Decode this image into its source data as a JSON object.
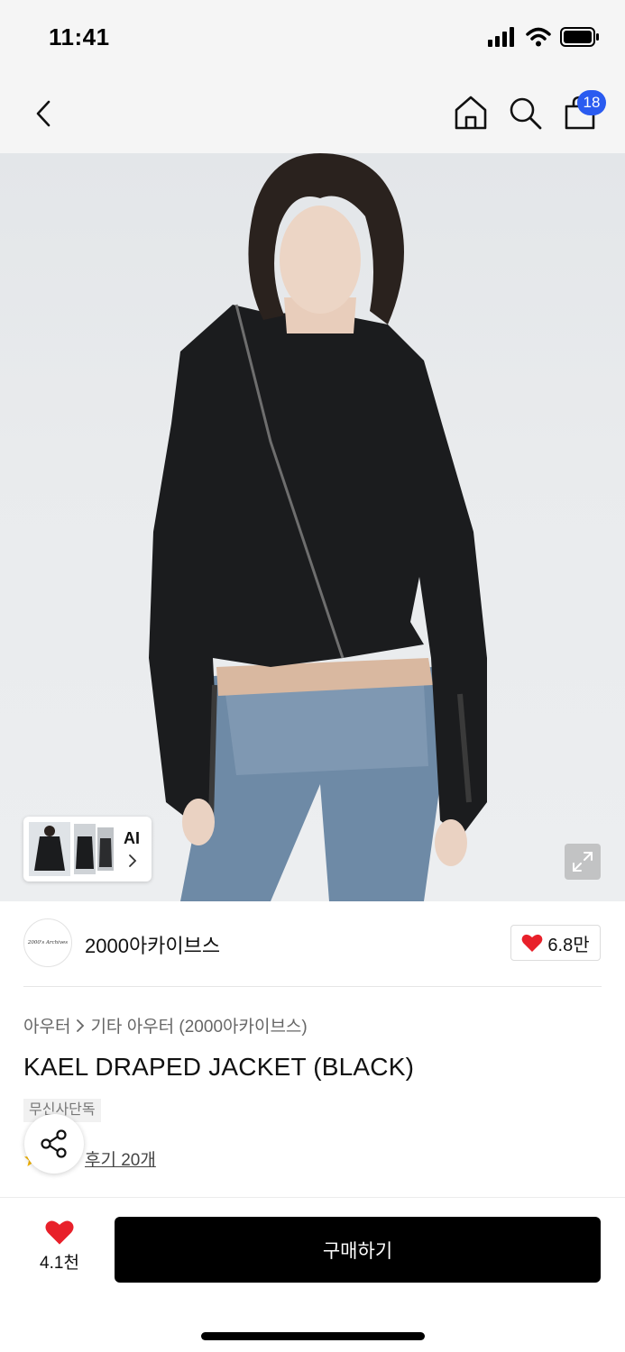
{
  "status_bar": {
    "time": "11:41"
  },
  "nav": {
    "cart_count": "18"
  },
  "gallery": {
    "ai_label": "AI"
  },
  "brand": {
    "logo_text": "2000's Archives",
    "name": "2000아카이브스",
    "like_count": "6.8만"
  },
  "product": {
    "breadcrumb": [
      "아우터",
      "기타 아우터 (2000아카이브스)"
    ],
    "title": "KAEL DRAPED JACKET (BLACK)",
    "tag": "무신사단독",
    "review_link": "후기 20개"
  },
  "bottom_bar": {
    "like_count": "4.1천",
    "buy_label": "구매하기"
  },
  "colors": {
    "accent_red": "#e8202a",
    "badge_blue": "#2a5bf0",
    "button_black": "#000000",
    "star": "#f4b400"
  },
  "icons": [
    "back-icon",
    "home-icon",
    "search-icon",
    "bag-icon",
    "expand-icon",
    "heart-icon",
    "share-icon",
    "star-icon",
    "chevron-right-icon"
  ]
}
